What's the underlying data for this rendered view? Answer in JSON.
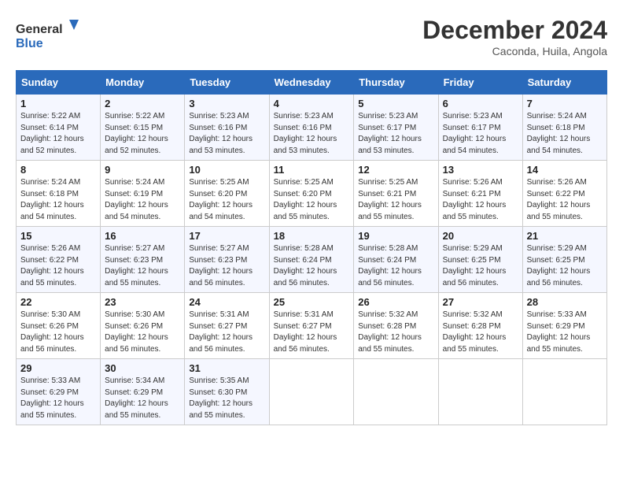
{
  "logo": {
    "line1": "General",
    "line2": "Blue"
  },
  "title": "December 2024",
  "location": "Caconda, Huila, Angola",
  "days_of_week": [
    "Sunday",
    "Monday",
    "Tuesday",
    "Wednesday",
    "Thursday",
    "Friday",
    "Saturday"
  ],
  "weeks": [
    [
      {
        "day": "1",
        "sunrise": "5:22 AM",
        "sunset": "6:14 PM",
        "daylight": "12 hours and 52 minutes."
      },
      {
        "day": "2",
        "sunrise": "5:22 AM",
        "sunset": "6:15 PM",
        "daylight": "12 hours and 52 minutes."
      },
      {
        "day": "3",
        "sunrise": "5:23 AM",
        "sunset": "6:16 PM",
        "daylight": "12 hours and 53 minutes."
      },
      {
        "day": "4",
        "sunrise": "5:23 AM",
        "sunset": "6:16 PM",
        "daylight": "12 hours and 53 minutes."
      },
      {
        "day": "5",
        "sunrise": "5:23 AM",
        "sunset": "6:17 PM",
        "daylight": "12 hours and 53 minutes."
      },
      {
        "day": "6",
        "sunrise": "5:23 AM",
        "sunset": "6:17 PM",
        "daylight": "12 hours and 54 minutes."
      },
      {
        "day": "7",
        "sunrise": "5:24 AM",
        "sunset": "6:18 PM",
        "daylight": "12 hours and 54 minutes."
      }
    ],
    [
      {
        "day": "8",
        "sunrise": "5:24 AM",
        "sunset": "6:18 PM",
        "daylight": "12 hours and 54 minutes."
      },
      {
        "day": "9",
        "sunrise": "5:24 AM",
        "sunset": "6:19 PM",
        "daylight": "12 hours and 54 minutes."
      },
      {
        "day": "10",
        "sunrise": "5:25 AM",
        "sunset": "6:20 PM",
        "daylight": "12 hours and 54 minutes."
      },
      {
        "day": "11",
        "sunrise": "5:25 AM",
        "sunset": "6:20 PM",
        "daylight": "12 hours and 55 minutes."
      },
      {
        "day": "12",
        "sunrise": "5:25 AM",
        "sunset": "6:21 PM",
        "daylight": "12 hours and 55 minutes."
      },
      {
        "day": "13",
        "sunrise": "5:26 AM",
        "sunset": "6:21 PM",
        "daylight": "12 hours and 55 minutes."
      },
      {
        "day": "14",
        "sunrise": "5:26 AM",
        "sunset": "6:22 PM",
        "daylight": "12 hours and 55 minutes."
      }
    ],
    [
      {
        "day": "15",
        "sunrise": "5:26 AM",
        "sunset": "6:22 PM",
        "daylight": "12 hours and 55 minutes."
      },
      {
        "day": "16",
        "sunrise": "5:27 AM",
        "sunset": "6:23 PM",
        "daylight": "12 hours and 55 minutes."
      },
      {
        "day": "17",
        "sunrise": "5:27 AM",
        "sunset": "6:23 PM",
        "daylight": "12 hours and 56 minutes."
      },
      {
        "day": "18",
        "sunrise": "5:28 AM",
        "sunset": "6:24 PM",
        "daylight": "12 hours and 56 minutes."
      },
      {
        "day": "19",
        "sunrise": "5:28 AM",
        "sunset": "6:24 PM",
        "daylight": "12 hours and 56 minutes."
      },
      {
        "day": "20",
        "sunrise": "5:29 AM",
        "sunset": "6:25 PM",
        "daylight": "12 hours and 56 minutes."
      },
      {
        "day": "21",
        "sunrise": "5:29 AM",
        "sunset": "6:25 PM",
        "daylight": "12 hours and 56 minutes."
      }
    ],
    [
      {
        "day": "22",
        "sunrise": "5:30 AM",
        "sunset": "6:26 PM",
        "daylight": "12 hours and 56 minutes."
      },
      {
        "day": "23",
        "sunrise": "5:30 AM",
        "sunset": "6:26 PM",
        "daylight": "12 hours and 56 minutes."
      },
      {
        "day": "24",
        "sunrise": "5:31 AM",
        "sunset": "6:27 PM",
        "daylight": "12 hours and 56 minutes."
      },
      {
        "day": "25",
        "sunrise": "5:31 AM",
        "sunset": "6:27 PM",
        "daylight": "12 hours and 56 minutes."
      },
      {
        "day": "26",
        "sunrise": "5:32 AM",
        "sunset": "6:28 PM",
        "daylight": "12 hours and 55 minutes."
      },
      {
        "day": "27",
        "sunrise": "5:32 AM",
        "sunset": "6:28 PM",
        "daylight": "12 hours and 55 minutes."
      },
      {
        "day": "28",
        "sunrise": "5:33 AM",
        "sunset": "6:29 PM",
        "daylight": "12 hours and 55 minutes."
      }
    ],
    [
      {
        "day": "29",
        "sunrise": "5:33 AM",
        "sunset": "6:29 PM",
        "daylight": "12 hours and 55 minutes."
      },
      {
        "day": "30",
        "sunrise": "5:34 AM",
        "sunset": "6:29 PM",
        "daylight": "12 hours and 55 minutes."
      },
      {
        "day": "31",
        "sunrise": "5:35 AM",
        "sunset": "6:30 PM",
        "daylight": "12 hours and 55 minutes."
      },
      null,
      null,
      null,
      null
    ]
  ]
}
